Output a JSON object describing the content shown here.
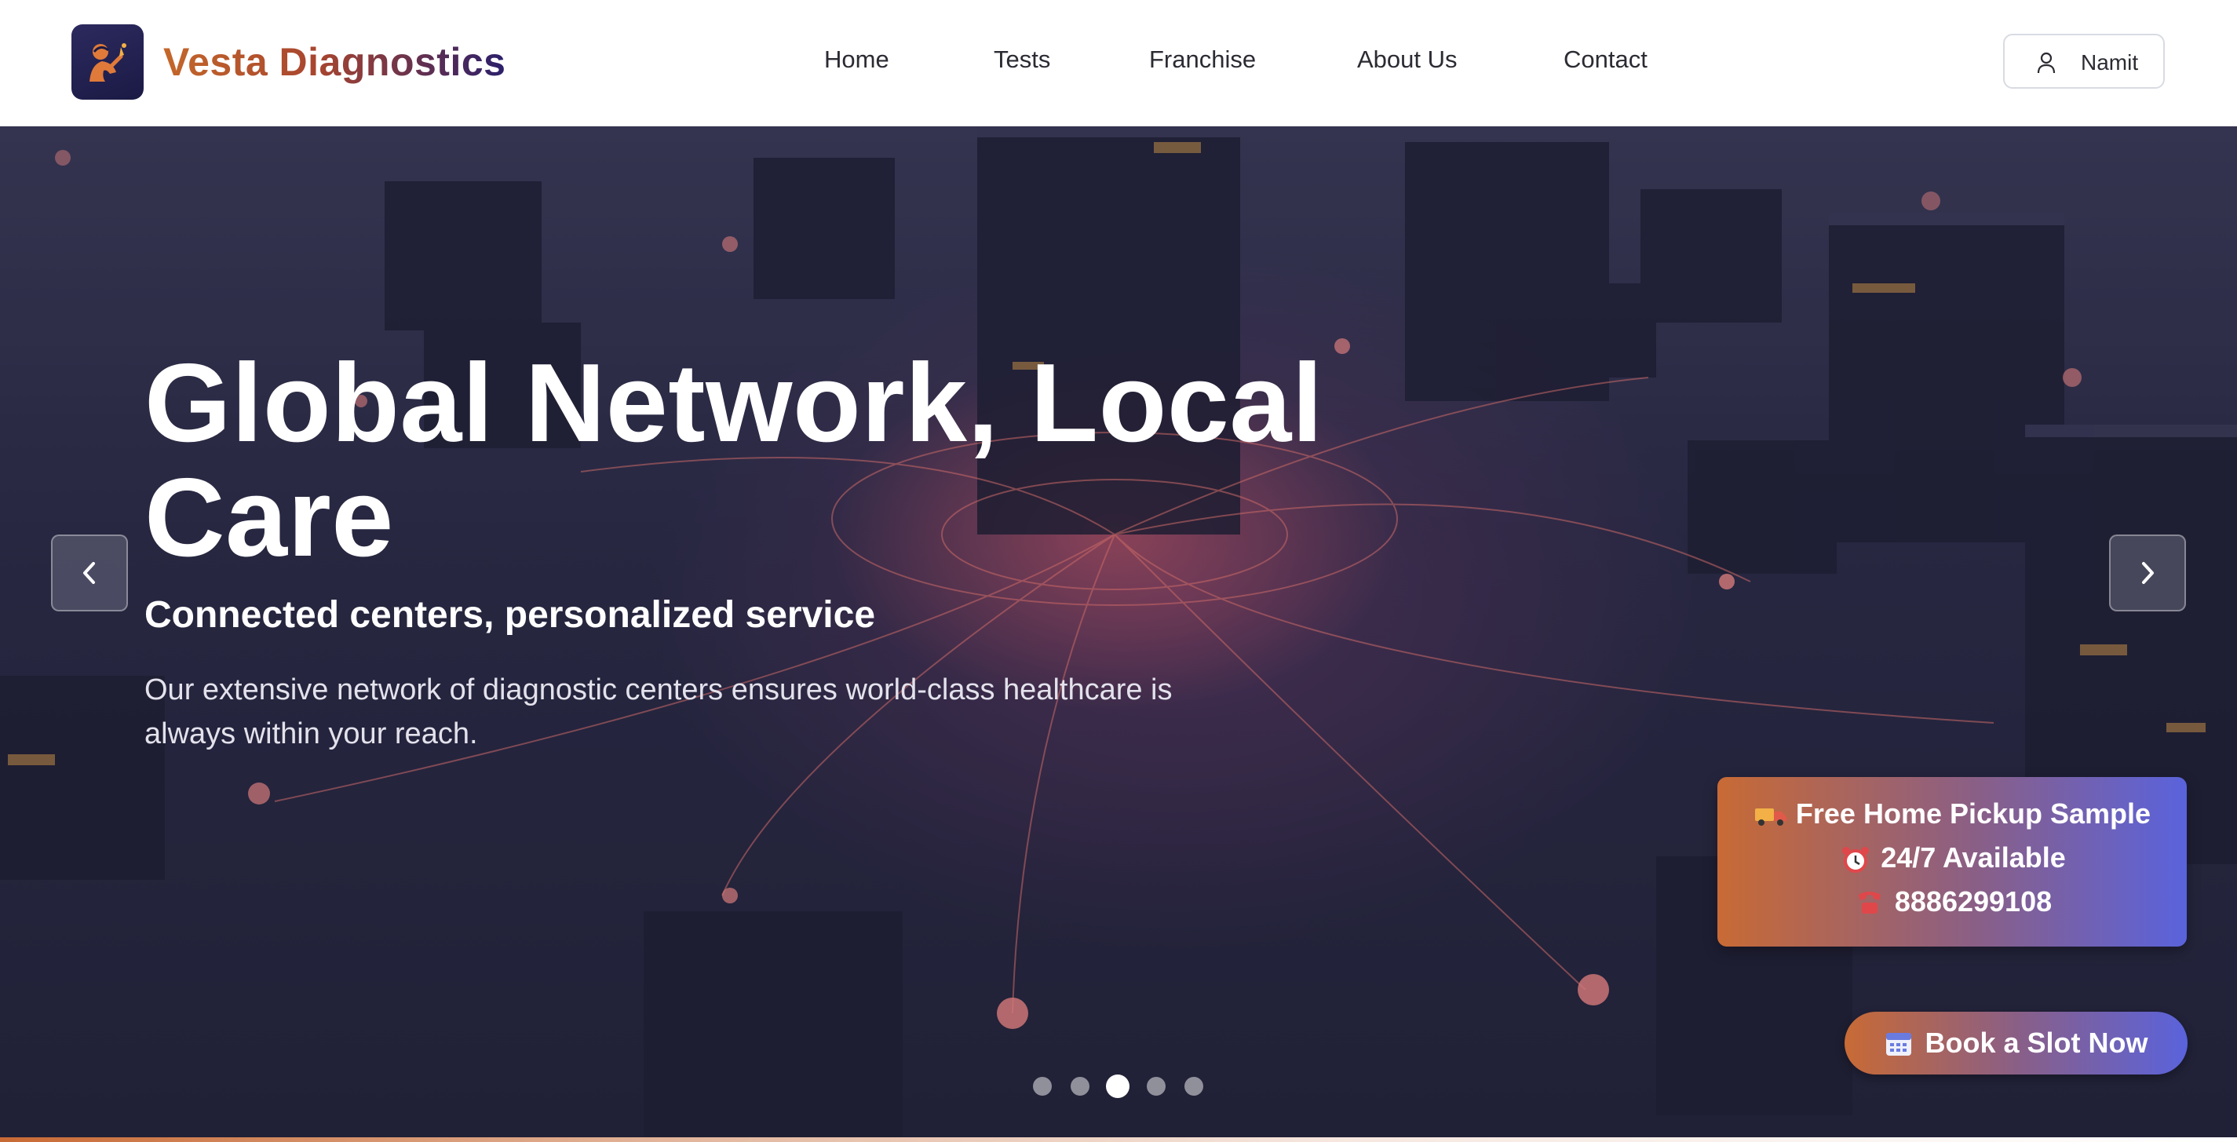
{
  "brand": {
    "name": "Vesta Diagnostics",
    "logo_icon": "lab-figure-icon",
    "colors": {
      "orange": "#c4672a",
      "indigo": "#2b1f6b",
      "badge": "#2c2a5e"
    }
  },
  "nav": {
    "items": [
      {
        "label": "Home"
      },
      {
        "label": "Tests"
      },
      {
        "label": "Franchise"
      },
      {
        "label": "About Us"
      },
      {
        "label": "Contact"
      }
    ]
  },
  "user": {
    "name": "Namit",
    "icon": "user-icon"
  },
  "hero": {
    "title": "Global Network, Local Care",
    "subtitle": "Connected centers, personalized service",
    "description": "Our extensive network of diagnostic centers ensures world-class healthcare is always within your reach.",
    "prev_icon": "chevron-left-icon",
    "next_icon": "chevron-right-icon",
    "slide_count": 5,
    "active_slide": 3
  },
  "promo": {
    "line1": "Free Home Pickup Sample",
    "line1_icon": "truck-icon",
    "line2": "24/7 Available",
    "line2_icon": "alarm-clock-icon",
    "line3": "8886299108",
    "line3_icon": "phone-icon"
  },
  "cta": {
    "label": "Book a Slot Now",
    "icon": "calendar-icon"
  }
}
